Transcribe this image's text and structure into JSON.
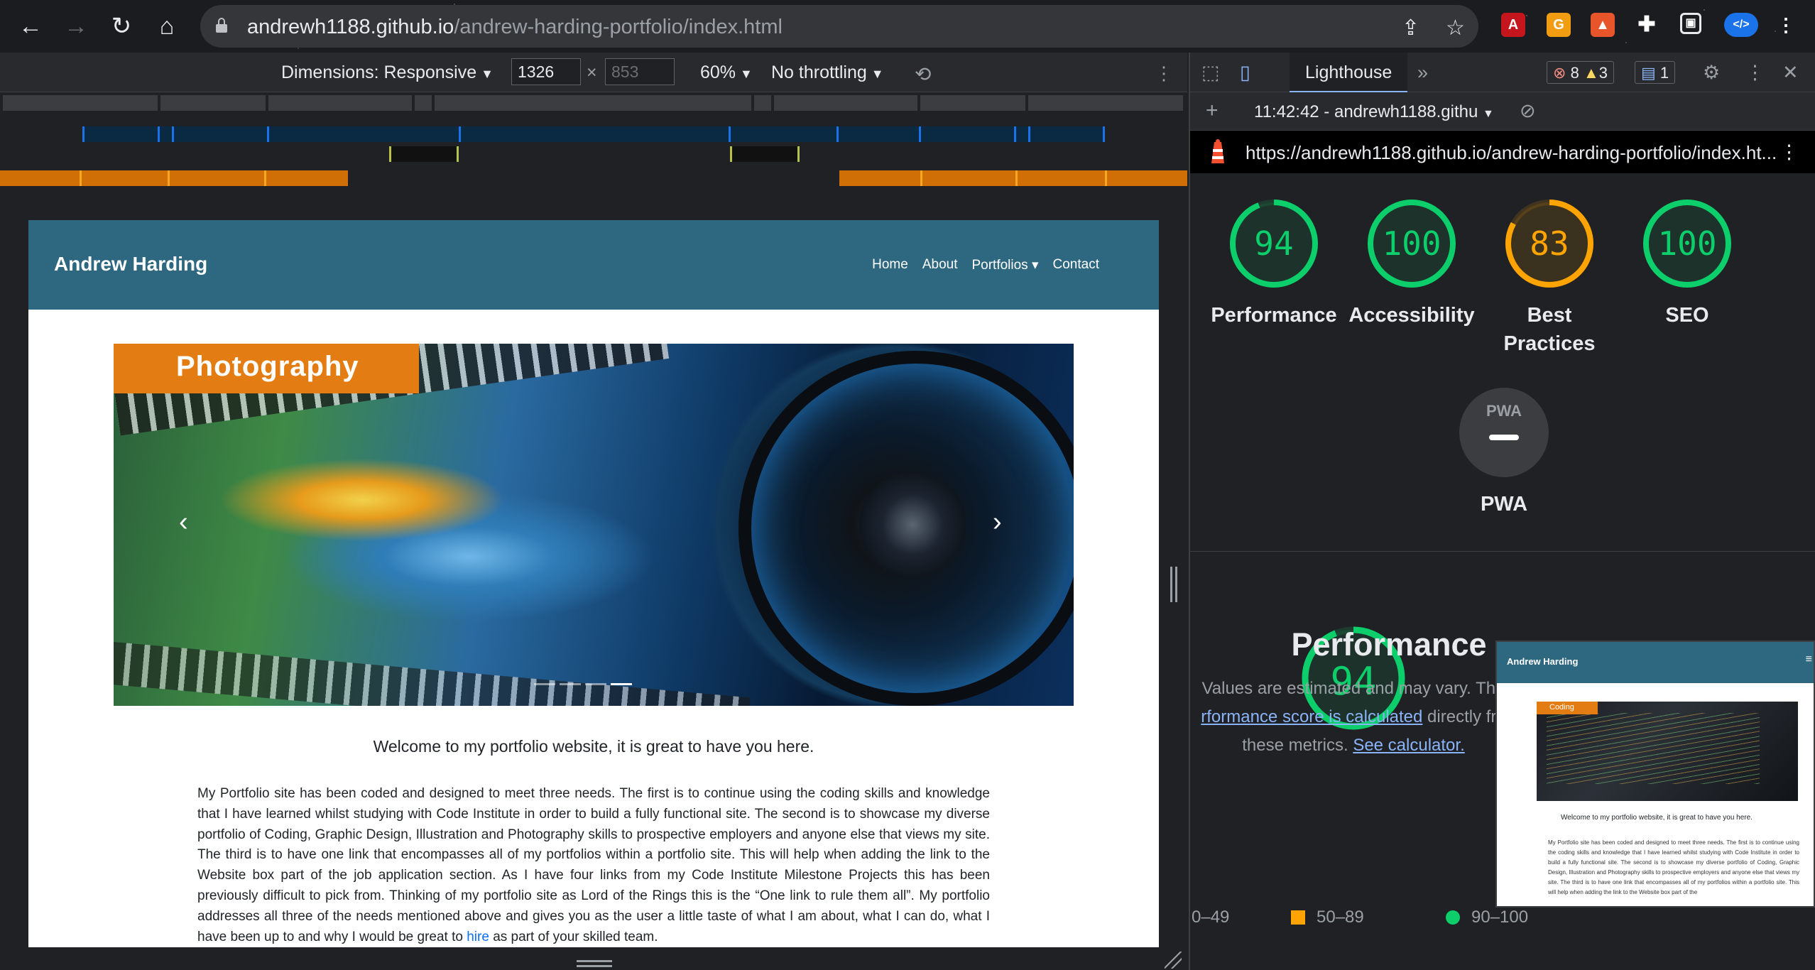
{
  "browser": {
    "url_host": "andrewh1188.github.io",
    "url_path": "/andrew-harding-portfolio/index.html"
  },
  "device_toolbar": {
    "dimensions_label": "Dimensions: Responsive",
    "width_value": "1326",
    "height_value": "853",
    "zoom": "60%",
    "throttling": "No throttling"
  },
  "site": {
    "brand": "Andrew Harding",
    "nav": [
      "Home",
      "About",
      "Portfolios",
      "Contact"
    ],
    "hero_badge": "Photography",
    "welcome": "Welcome to my portfolio website, it is great to have you here.",
    "paragraph_before_link": "My Portfolio site has been coded and designed to meet three needs. The first is to continue using the coding skills and knowledge that I have learned whilst studying with Code Institute in order to build a fully functional site. The second is to showcase my diverse portfolio of Coding, Graphic Design, Illustration and Photography skills to prospective employers and anyone else that views my site. The third is to have one link that encompasses all of my portfolios within a portfolio site. This will help when adding the link to the Website box part of the job application section. As I have four links from my Code Institute Milestone Projects this has been previously difficult to pick from. Thinking of my portfolio site as Lord of the Rings this is the “One link to rule them all”. My portfolio addresses all three of the needs mentioned above and gives you as the user a little taste of what I am about, what I can do, what I have been up to and why I would be great to",
    "paragraph_link": "hire",
    "paragraph_after_link": "as part of your skilled team."
  },
  "devtools": {
    "active_tab": "Lighthouse",
    "errors": "8",
    "warnings": "3",
    "messages": "1",
    "report_time": "11:42:42 - andrewh1188.githu",
    "report_url": "https://andrewh1188.github.io/andrew-harding-portfolio/index.ht...",
    "scores": [
      {
        "label": "Performance",
        "value": "94",
        "color": "#0cce6b"
      },
      {
        "label": "Accessibility",
        "value": "100",
        "color": "#0cce6b"
      },
      {
        "label": "Best Practices",
        "value": "83",
        "color": "#ffa400"
      },
      {
        "label": "SEO",
        "value": "100",
        "color": "#0cce6b"
      }
    ],
    "pwa_label": "PWA",
    "pwa_badge": "PWA",
    "performance": {
      "value": "94",
      "title": "Performance",
      "note_1": "Values are estimated and may vary. The",
      "note_link": "rformance score is calculated",
      "note_2": "directly fro",
      "note_3": "these metrics.",
      "see_calc": "See calculator."
    },
    "legend": {
      "low": "0–49",
      "mid": "50–89",
      "high": "90–100"
    },
    "thumbnail": {
      "brand": "Andrew Harding",
      "badge": "Coding",
      "welcome": "Welcome to my portfolio website, it is great to have you here.",
      "para": "My Portfolio site has been coded and designed to meet three needs. The first is to continue using the coding skills and knowledge that I have learned whilst studying with Code Institute in order to build a fully functional site. The second is to showcase my diverse portfolio of Coding, Graphic Design, Illustration and Photography skills to prospective employers and anyone else that views my site. The third is to have one link that encompasses all of my portfolios within a portfolio site. This will help when adding the link to the Website box part of the"
    }
  }
}
